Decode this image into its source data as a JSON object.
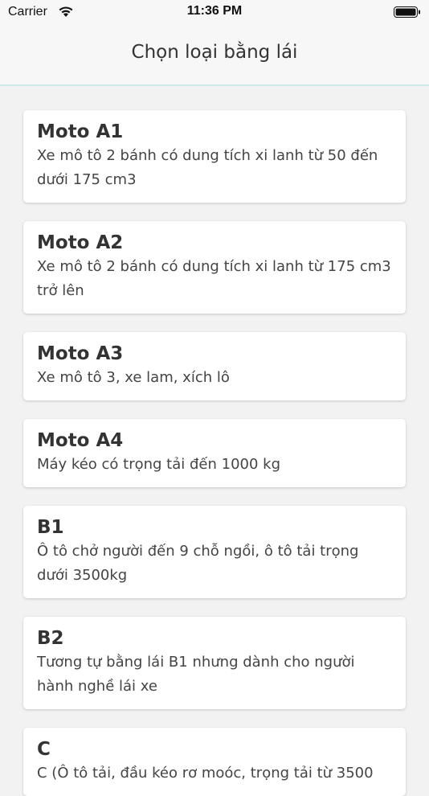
{
  "status_bar": {
    "carrier": "Carrier",
    "time": "11:36 PM"
  },
  "header": {
    "title": "Chọn loại bằng lái"
  },
  "licenses": [
    {
      "title": "Moto A1",
      "description": "Xe mô tô 2 bánh có dung tích xi lanh từ 50 đến dưới 175 cm3"
    },
    {
      "title": "Moto A2",
      "description": "Xe mô tô 2 bánh có dung tích xi lanh từ 175 cm3 trở lên"
    },
    {
      "title": "Moto A3",
      "description": "Xe mô tô 3, xe lam, xích lô"
    },
    {
      "title": "Moto A4",
      "description": "Máy kéo có trọng tải đến 1000 kg"
    },
    {
      "title": "B1",
      "description": "Ô tô chở người đến 9 chỗ ngồi, ô tô tải trọng dưới 3500kg"
    },
    {
      "title": "B2",
      "description": "Tương tự bằng lái B1 nhưng dành cho người hành nghề lái xe"
    },
    {
      "title": "C",
      "description": "C (Ô tô tải, đầu kéo rơ moóc, trọng tải từ 3500"
    }
  ]
}
